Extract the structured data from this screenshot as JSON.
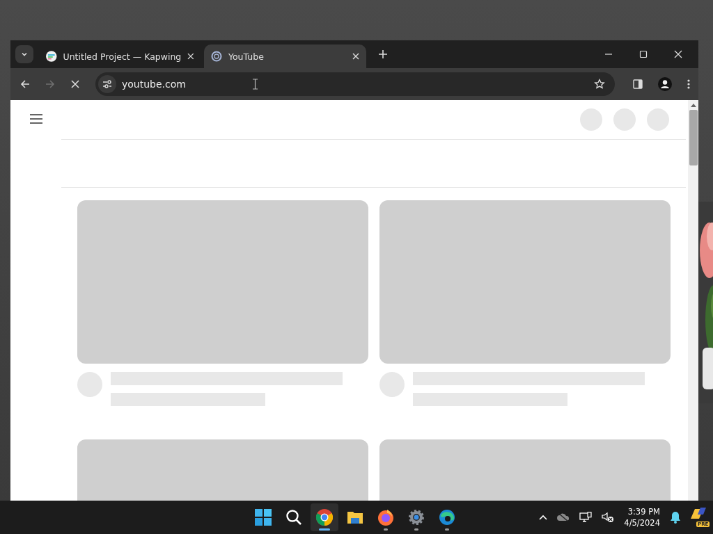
{
  "browser": {
    "tabs": [
      {
        "title": "Untitled Project — Kapwing",
        "selected": false,
        "kind": "kapwing"
      },
      {
        "title": "YouTube",
        "selected": true,
        "kind": "youtube"
      }
    ],
    "forward_disabled": true,
    "loading": true,
    "address": "youtube.com"
  },
  "taskbar": {
    "apps": [
      {
        "kind": "start",
        "selected": false,
        "running": false
      },
      {
        "kind": "search",
        "selected": false,
        "running": false
      },
      {
        "kind": "chrome",
        "selected": true,
        "running": true
      },
      {
        "kind": "folder",
        "selected": false,
        "running": false
      },
      {
        "kind": "firefox",
        "selected": false,
        "running": true
      },
      {
        "kind": "settings",
        "selected": false,
        "running": true
      },
      {
        "kind": "edge",
        "selected": false,
        "running": true
      }
    ],
    "time": "3:39 PM",
    "date": "4/5/2024",
    "app_badge": "PRE"
  }
}
